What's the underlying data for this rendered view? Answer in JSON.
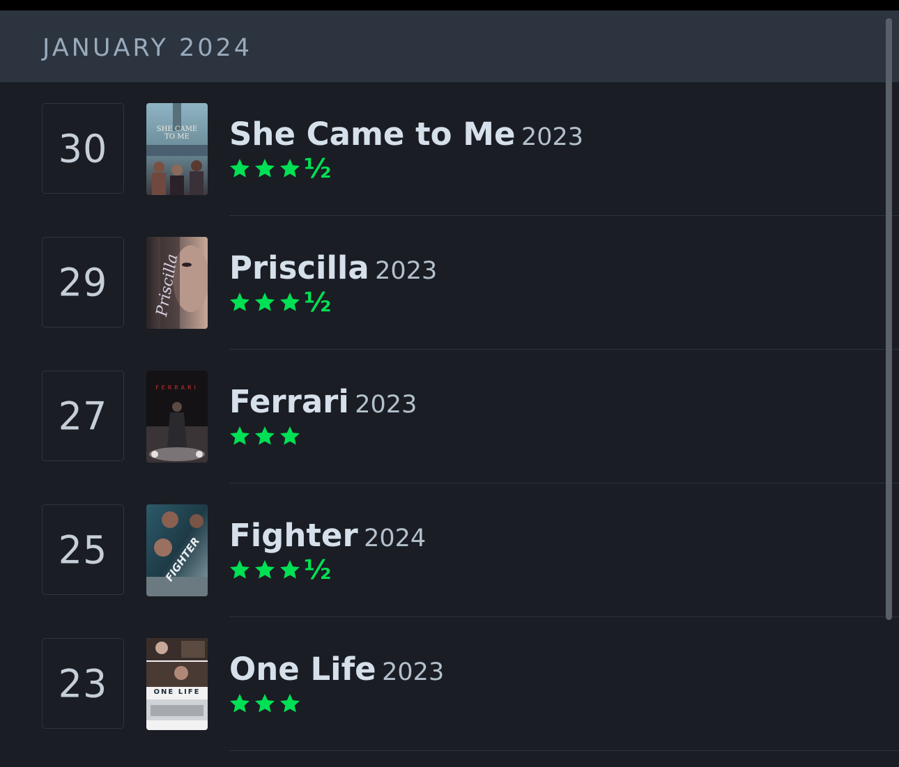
{
  "month_header": "JANUARY 2024",
  "entries": [
    {
      "day": "30",
      "title": "She Came to Me",
      "year": "2023",
      "rating": 3.5,
      "rating_text": "★★★½",
      "poster_text": "SHE CAME TO ME"
    },
    {
      "day": "29",
      "title": "Priscilla",
      "year": "2023",
      "rating": 3.5,
      "rating_text": "★★★½",
      "poster_text": "Priscilla"
    },
    {
      "day": "27",
      "title": "Ferrari",
      "year": "2023",
      "rating": 3,
      "rating_text": "★★★",
      "poster_text": "FERRARI"
    },
    {
      "day": "25",
      "title": "Fighter",
      "year": "2024",
      "rating": 3.5,
      "rating_text": "★★★½",
      "poster_text": "FIGHTER"
    },
    {
      "day": "23",
      "title": "One Life",
      "year": "2023",
      "rating": 3,
      "rating_text": "★★★",
      "poster_text": "ONE LIFE"
    }
  ],
  "colors": {
    "background": "#1a1d24",
    "header_background": "#2c3440",
    "star_green": "#00e054",
    "title_text": "#d6e0ea"
  },
  "icons": {
    "star": "star-icon",
    "half_star": "half-star-icon"
  }
}
